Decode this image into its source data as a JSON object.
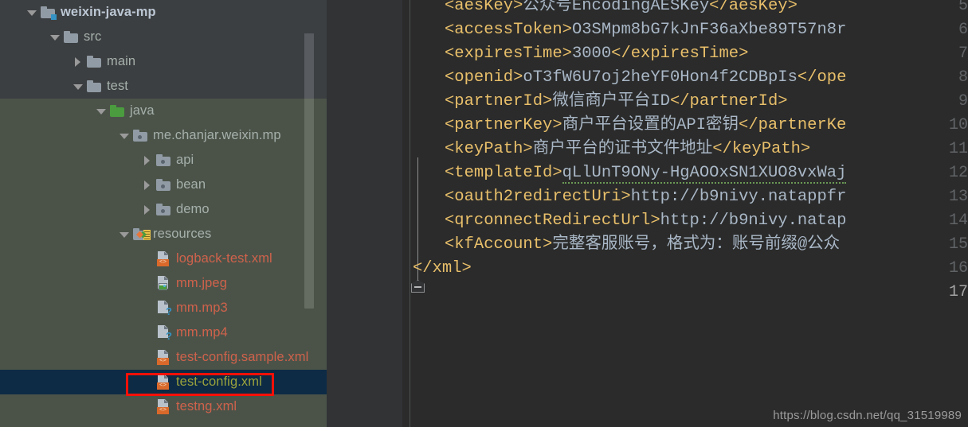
{
  "colors": {
    "tree_bg_dark": "#3c3f41",
    "tree_bg_highlight": "#4b5349",
    "tree_row_selected": "#0d2b45",
    "annotation_box": "#fc1008",
    "editor_bg": "#2b2b2b",
    "gutter_bg": "#313335",
    "xml_tag": "#e8bf6a",
    "xml_value": "#a9b7c6",
    "file_red": "#cf624b",
    "file_selected_text": "#9ba33c",
    "line_number": "#606366"
  },
  "project_tree": {
    "name": "project-tool-window",
    "rows": [
      {
        "label": "weixin-java-mp",
        "indent": 0,
        "twisty": "down",
        "icon": "module-folder-icon",
        "style": "bold"
      },
      {
        "label": "src",
        "indent": 1,
        "twisty": "down",
        "icon": "folder-icon",
        "style": "plain"
      },
      {
        "label": "main",
        "indent": 2,
        "twisty": "right",
        "icon": "folder-icon",
        "style": "plain"
      },
      {
        "label": "test",
        "indent": 2,
        "twisty": "down",
        "icon": "folder-icon",
        "style": "plain"
      },
      {
        "label": "java",
        "indent": 3,
        "twisty": "down",
        "icon": "source-root-folder-icon",
        "style": "plain"
      },
      {
        "label": "me.chanjar.weixin.mp",
        "indent": 4,
        "twisty": "down",
        "icon": "package-icon",
        "style": "plain"
      },
      {
        "label": "api",
        "indent": 5,
        "twisty": "right",
        "icon": "package-icon",
        "style": "plain"
      },
      {
        "label": "bean",
        "indent": 5,
        "twisty": "right",
        "icon": "package-icon",
        "style": "plain"
      },
      {
        "label": "demo",
        "indent": 5,
        "twisty": "right",
        "icon": "package-icon",
        "style": "plain"
      },
      {
        "label": "resources",
        "indent": 4,
        "twisty": "down",
        "icon": "resources-root-folder-icon",
        "style": "plain"
      },
      {
        "label": "logback-test.xml",
        "indent": 5,
        "twisty": "none",
        "icon": "xml-file-icon",
        "style": "red"
      },
      {
        "label": "mm.jpeg",
        "indent": 5,
        "twisty": "none",
        "icon": "image-file-icon",
        "style": "red"
      },
      {
        "label": "mm.mp3",
        "indent": 5,
        "twisty": "none",
        "icon": "unknown-file-icon",
        "style": "red"
      },
      {
        "label": "mm.mp4",
        "indent": 5,
        "twisty": "none",
        "icon": "unknown-file-icon",
        "style": "red"
      },
      {
        "label": "test-config.sample.xml",
        "indent": 5,
        "twisty": "none",
        "icon": "xml-file-icon",
        "style": "red"
      },
      {
        "label": "test-config.xml",
        "indent": 5,
        "twisty": "none",
        "icon": "xml-file-icon",
        "style": "olive",
        "selected": true,
        "annotated": true
      },
      {
        "label": "testng.xml",
        "indent": 5,
        "twisty": "none",
        "icon": "xml-file-icon",
        "style": "red"
      }
    ]
  },
  "editor": {
    "name": "xml-editor",
    "current_line": 17,
    "line_numbers": [
      "5",
      "6",
      "7",
      "8",
      "9",
      "10",
      "11",
      "12",
      "13",
      "14",
      "15",
      "16",
      "17"
    ],
    "lines": [
      {
        "n": "5",
        "tag_open": "<aesKey>",
        "value": "公众号EncodingAESKey",
        "tag_close": "</aesKey>"
      },
      {
        "n": "6",
        "tag_open": "<accessToken>",
        "value": "O3SMpm8bG7kJnF36aXbe89T57n8r",
        "tag_close": ""
      },
      {
        "n": "7",
        "tag_open": "<expiresTime>",
        "value": "3000",
        "tag_close": "</expiresTime>"
      },
      {
        "n": "8",
        "tag_open": "<openid>",
        "value": "oT3fW6U7oj2heYF0Hon4f2CDBpIs",
        "tag_close": "</ope"
      },
      {
        "n": "9",
        "tag_open": "<partnerId>",
        "value": "微信商户平台ID",
        "tag_close": "</partnerId>"
      },
      {
        "n": "10",
        "tag_open": "<partnerKey>",
        "value": "商户平台设置的API密钥",
        "tag_close": "</partnerKe"
      },
      {
        "n": "11",
        "tag_open": "<keyPath>",
        "value": "商户平台的证书文件地址",
        "tag_close": "</keyPath>"
      },
      {
        "n": "12",
        "tag_open": "<templateId>",
        "value": "qLlUnT9ONy-HgAOOxSN1XUO8vxWaj",
        "tag_close": ""
      },
      {
        "n": "13",
        "tag_open": "<oauth2redirectUri>",
        "value": "http://b9nivy.natappfr",
        "tag_close": ""
      },
      {
        "n": "14",
        "tag_open": "<qrconnectRedirectUrl>",
        "value": "http://b9nivy.natap",
        "tag_close": ""
      },
      {
        "n": "15",
        "tag_open": "<kfAccount>",
        "value": "完整客服账号，格式为：账号前缀@公众",
        "tag_close": ""
      },
      {
        "n": "16",
        "tag_open": "</xml>",
        "value": "",
        "tag_close": ""
      },
      {
        "n": "17",
        "tag_open": "",
        "value": "",
        "tag_close": ""
      }
    ]
  },
  "watermark": {
    "text": "https://blog.csdn.net/qq_31519989"
  }
}
